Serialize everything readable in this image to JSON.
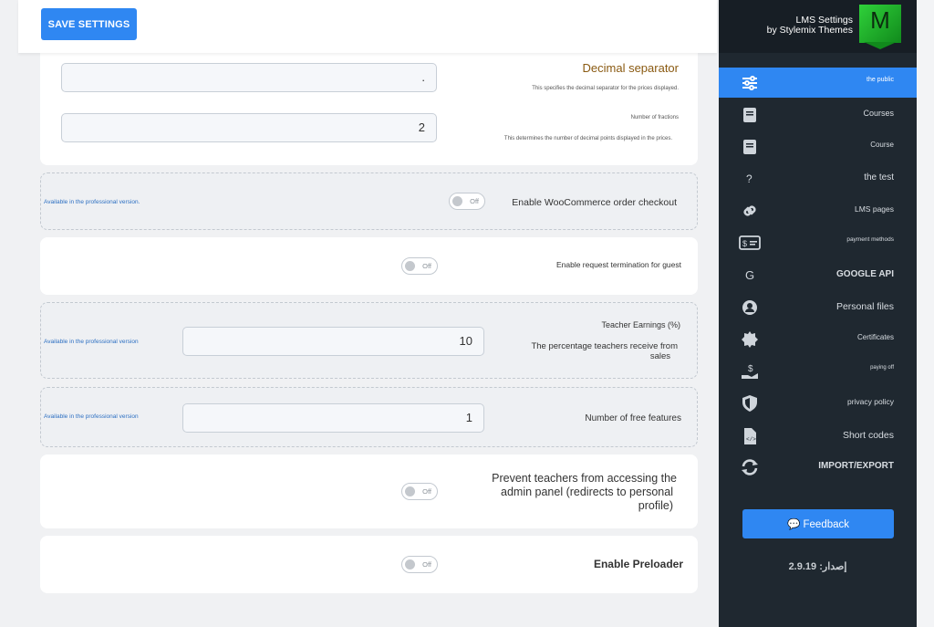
{
  "toolbar": {
    "save_label": "SAVE SETTINGS"
  },
  "currency": {
    "decimal_separator_label": "Decimal separator",
    "decimal_separator_help": "This specifies the decimal separator for the prices displayed.",
    "decimal_separator_value": ".",
    "fractions_label": "Number of fractions",
    "fractions_help": "This determines the number of decimal points displayed in the prices.",
    "fractions_value": "2"
  },
  "pro_note": "Available in the professional version.",
  "pro_note_short": "Available in the professional version",
  "woocommerce": {
    "label": "Enable WooCommerce order checkout",
    "toggle": "Off"
  },
  "guest_request": {
    "label": "Enable request termination for guest",
    "toggle": "Off"
  },
  "teacher_earnings": {
    "label": "Teacher Earnings (%)",
    "help_line1": "The percentage teachers receive from",
    "help_line2": "sales",
    "value": "10"
  },
  "free_features": {
    "label": "Number of free features",
    "value": "1"
  },
  "admin_panel": {
    "line1": "Prevent teachers from accessing the",
    "line2": "admin panel (redirects to personal",
    "line3": "profile)",
    "toggle": "Off"
  },
  "preloader": {
    "label": "Enable Preloader",
    "toggle": "Off"
  },
  "sidebar": {
    "title_line1": "LMS Settings",
    "title_line2": "by Stylemix Themes",
    "logo_letter": "M",
    "items": [
      {
        "label": "the public",
        "icon": "sliders-icon"
      },
      {
        "label": "Courses",
        "icon": "book-icon"
      },
      {
        "label": "Course",
        "icon": "book-icon"
      },
      {
        "label": "the test",
        "icon": "question-icon"
      },
      {
        "label": "LMS pages",
        "icon": "link-icon"
      },
      {
        "label": "payment methods",
        "icon": "payment-icon"
      },
      {
        "label": "GOOGLE API",
        "icon": "google-icon"
      },
      {
        "label": "Personal files",
        "icon": "user-icon"
      },
      {
        "label": "Certificates",
        "icon": "certificate-icon"
      },
      {
        "label": "paying off",
        "icon": "payout-icon"
      },
      {
        "label": "privacy policy",
        "icon": "shield-icon"
      },
      {
        "label": "Short codes",
        "icon": "code-file-icon"
      },
      {
        "label": "IMPORT/EXPORT",
        "icon": "sync-icon"
      }
    ],
    "feedback_label": "Feedback",
    "version": "إصدار: 2.9.19"
  },
  "colors": {
    "accent": "#2f87f2",
    "sidebar_bg": "#1f2830",
    "orange_label": "#8a5a12"
  }
}
